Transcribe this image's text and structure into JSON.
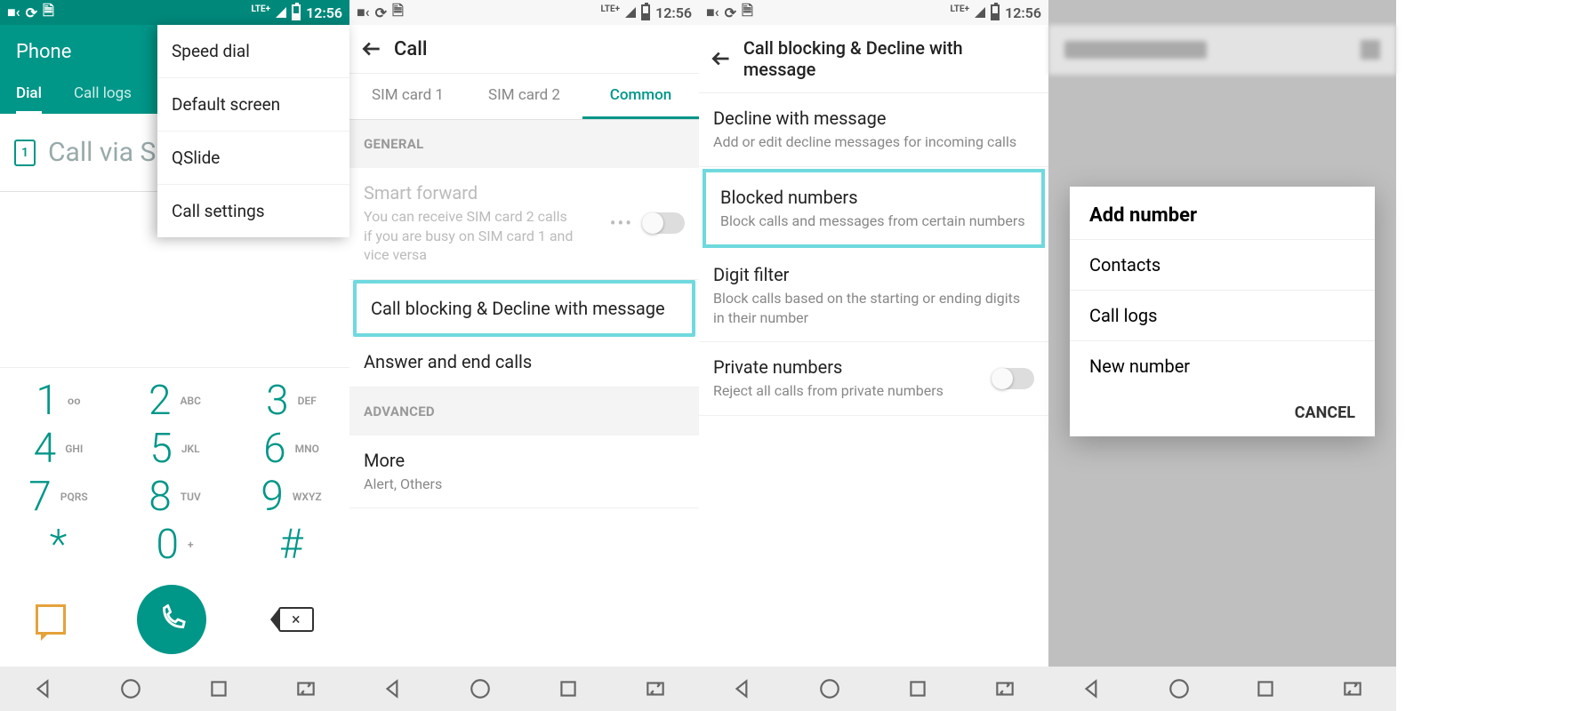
{
  "status": {
    "time": "12:56",
    "lte": "LTE+"
  },
  "s1": {
    "app_title": "Phone",
    "tabs": [
      "Dial",
      "Call logs"
    ],
    "sim_badge": "1",
    "dial_placeholder": "Call via SI",
    "menu": [
      "Speed dial",
      "Default screen",
      "QSlide",
      "Call settings"
    ],
    "keys": [
      {
        "n": "1",
        "l": "ᴏᴏ"
      },
      {
        "n": "2",
        "l": "ABC"
      },
      {
        "n": "3",
        "l": "DEF"
      },
      {
        "n": "4",
        "l": "GHI"
      },
      {
        "n": "5",
        "l": "JKL"
      },
      {
        "n": "6",
        "l": "MNO"
      },
      {
        "n": "7",
        "l": "PQRS"
      },
      {
        "n": "8",
        "l": "TUV"
      },
      {
        "n": "9",
        "l": "WXYZ"
      },
      {
        "n": "*",
        "l": ""
      },
      {
        "n": "0",
        "l": "+"
      },
      {
        "n": "#",
        "l": ""
      }
    ]
  },
  "s2": {
    "title": "Call",
    "subtabs": [
      "SIM card 1",
      "SIM card 2",
      "Common"
    ],
    "sec_general": "GENERAL",
    "sec_advanced": "ADVANCED",
    "smart_forward": {
      "t": "Smart forward",
      "s": "You can receive SIM card 2 calls if you are busy on SIM card 1 and vice versa"
    },
    "callblock": "Call blocking & Decline with message",
    "answer": "Answer and end calls",
    "more": {
      "t": "More",
      "s": "Alert, Others"
    }
  },
  "s3": {
    "title": "Call blocking & Decline with message",
    "decline": {
      "t": "Decline with message",
      "s": "Add or edit decline messages for incoming calls"
    },
    "blocked": {
      "t": "Blocked numbers",
      "s": "Block calls and messages from certain numbers"
    },
    "digit": {
      "t": "Digit filter",
      "s": "Block calls based on the starting or ending digits in their number"
    },
    "private": {
      "t": "Private numbers",
      "s": "Reject all calls from private numbers"
    }
  },
  "s4": {
    "dialog_title": "Add number",
    "items": [
      "Contacts",
      "Call logs",
      "New number"
    ],
    "cancel": "CANCEL"
  }
}
